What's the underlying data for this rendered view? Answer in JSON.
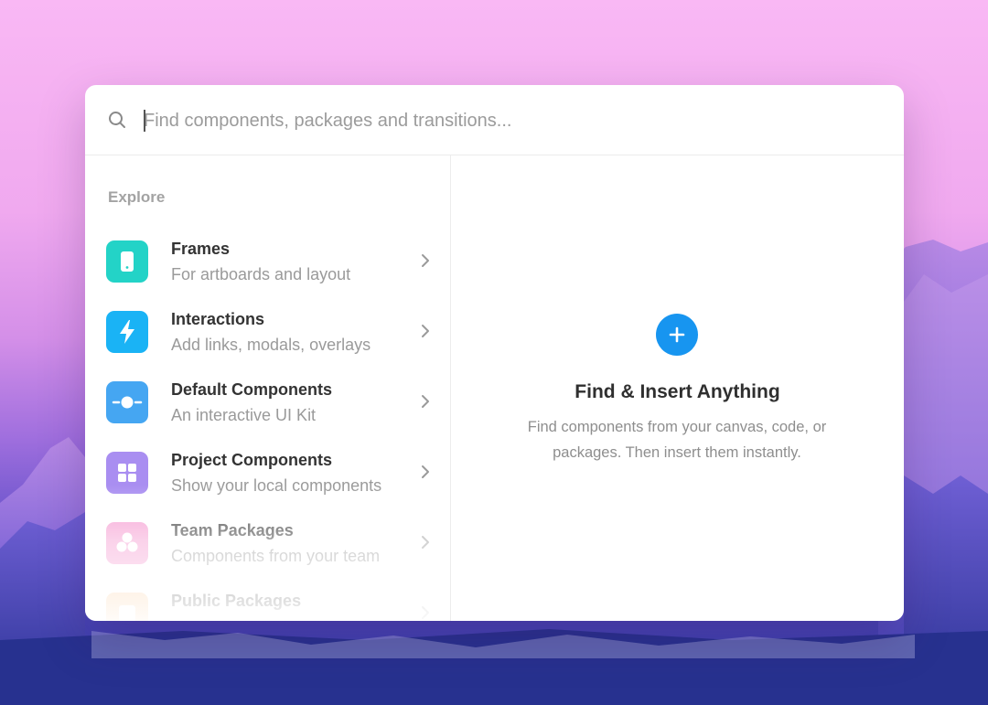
{
  "search": {
    "placeholder": "Find components, packages and transitions..."
  },
  "sidebar": {
    "heading": "Explore",
    "items": [
      {
        "title": "Frames",
        "subtitle": "For artboards and layout",
        "icon": "phone-frame-icon",
        "color": "#23d3c7"
      },
      {
        "title": "Interactions",
        "subtitle": "Add links, modals, overlays",
        "icon": "lightning-icon",
        "color": "#1ab3f5"
      },
      {
        "title": "Default Components",
        "subtitle": "An interactive UI Kit",
        "icon": "slider-toggle-icon",
        "color": "#45a6f2"
      },
      {
        "title": "Project Components",
        "subtitle": "Show your local components",
        "icon": "grid-icon",
        "color": "#a98ef1"
      },
      {
        "title": "Team Packages",
        "subtitle": "Components from your team",
        "icon": "circles-icon",
        "color": "#f59ad0"
      },
      {
        "title": "Public Packages",
        "subtitle": "",
        "icon": "package-icon",
        "color": "#fbc38a"
      }
    ]
  },
  "detail": {
    "title": "Find & Insert Anything",
    "description": "Find components from your canvas, code, or packages. Then insert them instantly.",
    "accent": "#1795f0"
  }
}
